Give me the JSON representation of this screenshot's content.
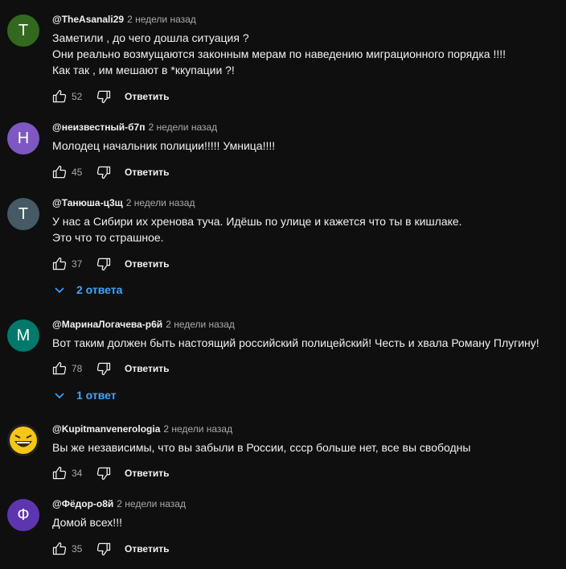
{
  "reply_label": "Ответить",
  "comments": [
    {
      "author": "@TheAsanali29",
      "time": "2 недели назад",
      "avatar_letter": "T",
      "avatar_color": "#33691e",
      "lines": [
        "Заметили , до чего дошла ситуация ?",
        "Они реально возмущаются законным мерам по наведению миграционного порядка !!!!",
        "Как так , им мешают в *ккупации ?!"
      ],
      "likes": "52"
    },
    {
      "author": "@неизвестный-б7п",
      "time": "2 недели назад",
      "avatar_letter": "Н",
      "avatar_color": "#7e57c2",
      "lines": [
        "Молодец начальник полиции!!!!! Умница!!!!"
      ],
      "likes": "45"
    },
    {
      "author": "@Танюша-ц3щ",
      "time": "2 недели назад",
      "avatar_letter": "Т",
      "avatar_color": "#455a64",
      "lines": [
        "У нас а Сибири их хренова туча. Идёшь по улице и кажется что ты в кишлаке.",
        "Это что то страшное."
      ],
      "likes": "37",
      "replies": "2 ответа"
    },
    {
      "author": "@МаринаЛогачева-р6й",
      "time": "2 недели назад",
      "avatar_letter": "М",
      "avatar_color": "#00796b",
      "lines": [
        "Вот таким должен быть настоящий российский полицейский! Честь и хвала Роману Плугину!"
      ],
      "likes": "78",
      "replies": "1 ответ"
    },
    {
      "author": "@Kupitmanvenerologia",
      "time": "2 недели назад",
      "avatar_letter": "",
      "avatar_color": "#f5c518",
      "avatar_icon": "laughing-face",
      "lines": [
        "Вы же независимы, что вы забыли в России, ссср больше нет, все вы свободны"
      ],
      "likes": "34"
    },
    {
      "author": "@Фёдор-о8й",
      "time": "2 недели назад",
      "avatar_letter": "Ф",
      "avatar_color": "#5e35b1",
      "lines": [
        "Домой всех!!!"
      ],
      "likes": "35"
    }
  ]
}
